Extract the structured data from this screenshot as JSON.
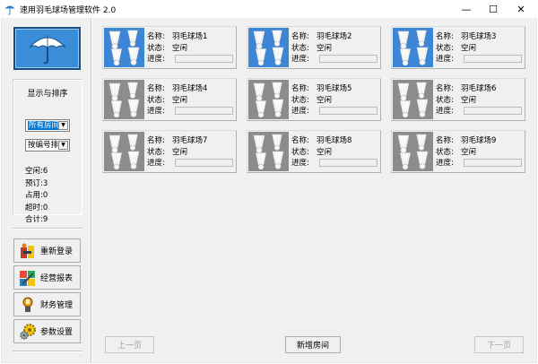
{
  "window": {
    "title": "速用羽毛球场管理软件 2.0",
    "controls": {
      "minimize": "—",
      "maximize": "☐",
      "close": "✕"
    }
  },
  "sidebar": {
    "logo_icon": "umbrella-icon",
    "group_title": "显示与排序",
    "filter_select": {
      "value": "所有房间"
    },
    "sort_select": {
      "value": "按编号排"
    },
    "stats": [
      {
        "label": "空闲",
        "value": "6"
      },
      {
        "label": "预订",
        "value": "3"
      },
      {
        "label": "占用",
        "value": "0"
      },
      {
        "label": "超时",
        "value": "0"
      },
      {
        "label": "合计",
        "value": "9"
      }
    ],
    "buttons": [
      {
        "label": "重新登录",
        "icon": "relogin-icon"
      },
      {
        "label": "经营报表",
        "icon": "report-icon"
      },
      {
        "label": "财务管理",
        "icon": "finance-icon"
      },
      {
        "label": "参数设置",
        "icon": "settings-gear-icon"
      }
    ]
  },
  "labels": {
    "name": "名称:",
    "status": "状态:",
    "progress": "进度:"
  },
  "courts": [
    {
      "name": "羽毛球场1",
      "status": "空闲",
      "progress": 0,
      "theme": "blue"
    },
    {
      "name": "羽毛球场2",
      "status": "空闲",
      "progress": 0,
      "theme": "blue"
    },
    {
      "name": "羽毛球场3",
      "status": "空闲",
      "progress": 0,
      "theme": "blue"
    },
    {
      "name": "羽毛球场4",
      "status": "空闲",
      "progress": 0,
      "theme": "gray"
    },
    {
      "name": "羽毛球场5",
      "status": "空闲",
      "progress": 0,
      "theme": "gray"
    },
    {
      "name": "羽毛球场6",
      "status": "空闲",
      "progress": 0,
      "theme": "gray"
    },
    {
      "name": "羽毛球场7",
      "status": "空闲",
      "progress": 0,
      "theme": "gray"
    },
    {
      "name": "羽毛球场8",
      "status": "空闲",
      "progress": 0,
      "theme": "gray"
    },
    {
      "name": "羽毛球场9",
      "status": "空闲",
      "progress": 0,
      "theme": "gray"
    }
  ],
  "bottom": {
    "prev": "上一页",
    "add": "新增房间",
    "next": "下一页"
  },
  "colors": {
    "blue_court": "#3d86d6",
    "gray_court": "#8c8c8c",
    "progress": "#06b025",
    "selection": "#0078d7"
  }
}
